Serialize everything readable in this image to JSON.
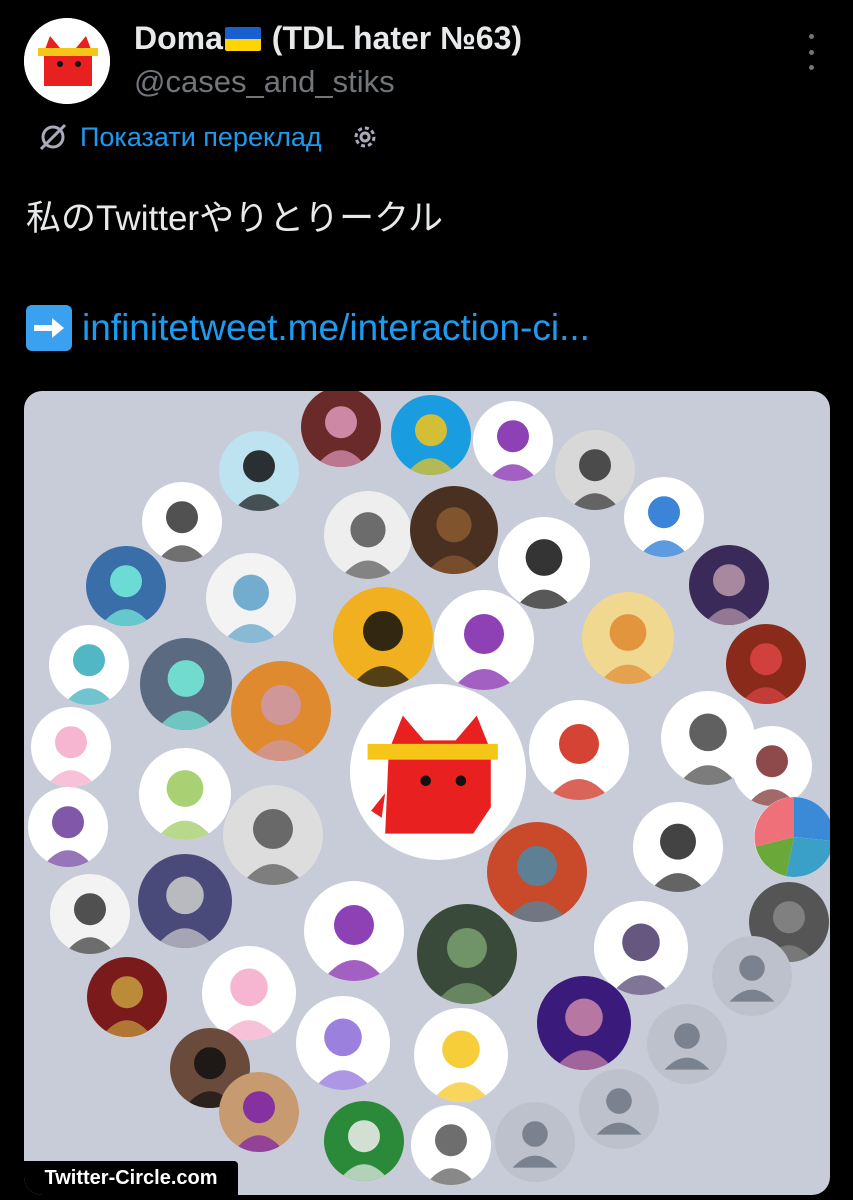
{
  "tweet": {
    "display_name_before_flag": "Doma",
    "display_name_after_flag": " (TDL hater №63)",
    "flag": "ukraine-flag",
    "handle": "@cases_and_stiks",
    "translate_label": "Показати переклад",
    "text": "私のTwitterやりとりークル",
    "link_text": "infinitetweet.me/interaction-ci...",
    "link_prefix_icon": "right-arrow-emoji-icon"
  },
  "media": {
    "watermark": "Twitter-Circle.com",
    "background_color": "#c8ccd8"
  },
  "colors": {
    "background": "#000000",
    "text": "#e7e9ea",
    "secondary": "#71767b",
    "link": "#1d9bf0",
    "mascot_red": "#e8201f",
    "mascot_headband": "#f5c518"
  }
}
